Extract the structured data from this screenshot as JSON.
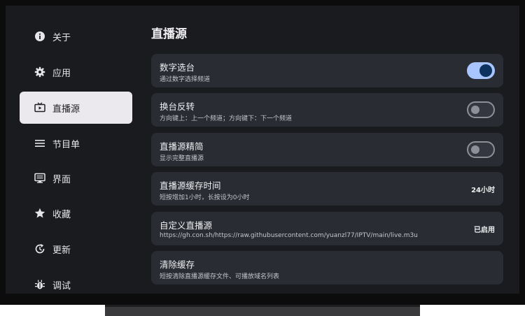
{
  "sidebar": {
    "items": [
      {
        "label": "关于",
        "icon": "info-icon"
      },
      {
        "label": "应用",
        "icon": "gear-icon"
      },
      {
        "label": "直播源",
        "icon": "tv-icon"
      },
      {
        "label": "节目单",
        "icon": "list-icon"
      },
      {
        "label": "界面",
        "icon": "monitor-icon"
      },
      {
        "label": "收藏",
        "icon": "star-icon"
      },
      {
        "label": "更新",
        "icon": "refresh-icon"
      },
      {
        "label": "调试",
        "icon": "bug-icon"
      }
    ],
    "active": "直播源"
  },
  "main": {
    "title": "直播源",
    "settings": [
      {
        "title": "数字选台",
        "subtitle": "通过数字选择频道",
        "control": "toggle",
        "checked": true
      },
      {
        "title": "换台反转",
        "subtitle": "方向键上：上一个频道；方向键下：下一个频道",
        "control": "toggle",
        "checked": false
      },
      {
        "title": "直播源精简",
        "subtitle": "显示完整直播源",
        "control": "toggle",
        "checked": false
      },
      {
        "title": "直播源缓存时间",
        "subtitle": "短按增加1小时，长按设为0小时",
        "control": "value",
        "value": "24小时"
      },
      {
        "title": "自定义直播源",
        "subtitle": "https://gh.con.sh/https://raw.githubusercontent.com/yuanzl77/IPTV/main/live.m3u",
        "control": "value",
        "value": "已启用"
      },
      {
        "title": "清除缓存",
        "subtitle": "短按清除直播源缓存文件、可播放域名列表",
        "control": "none"
      }
    ]
  },
  "colors": {
    "accent": "#a9c5ff",
    "card": "#292c33",
    "background": "#1a1b1f"
  }
}
